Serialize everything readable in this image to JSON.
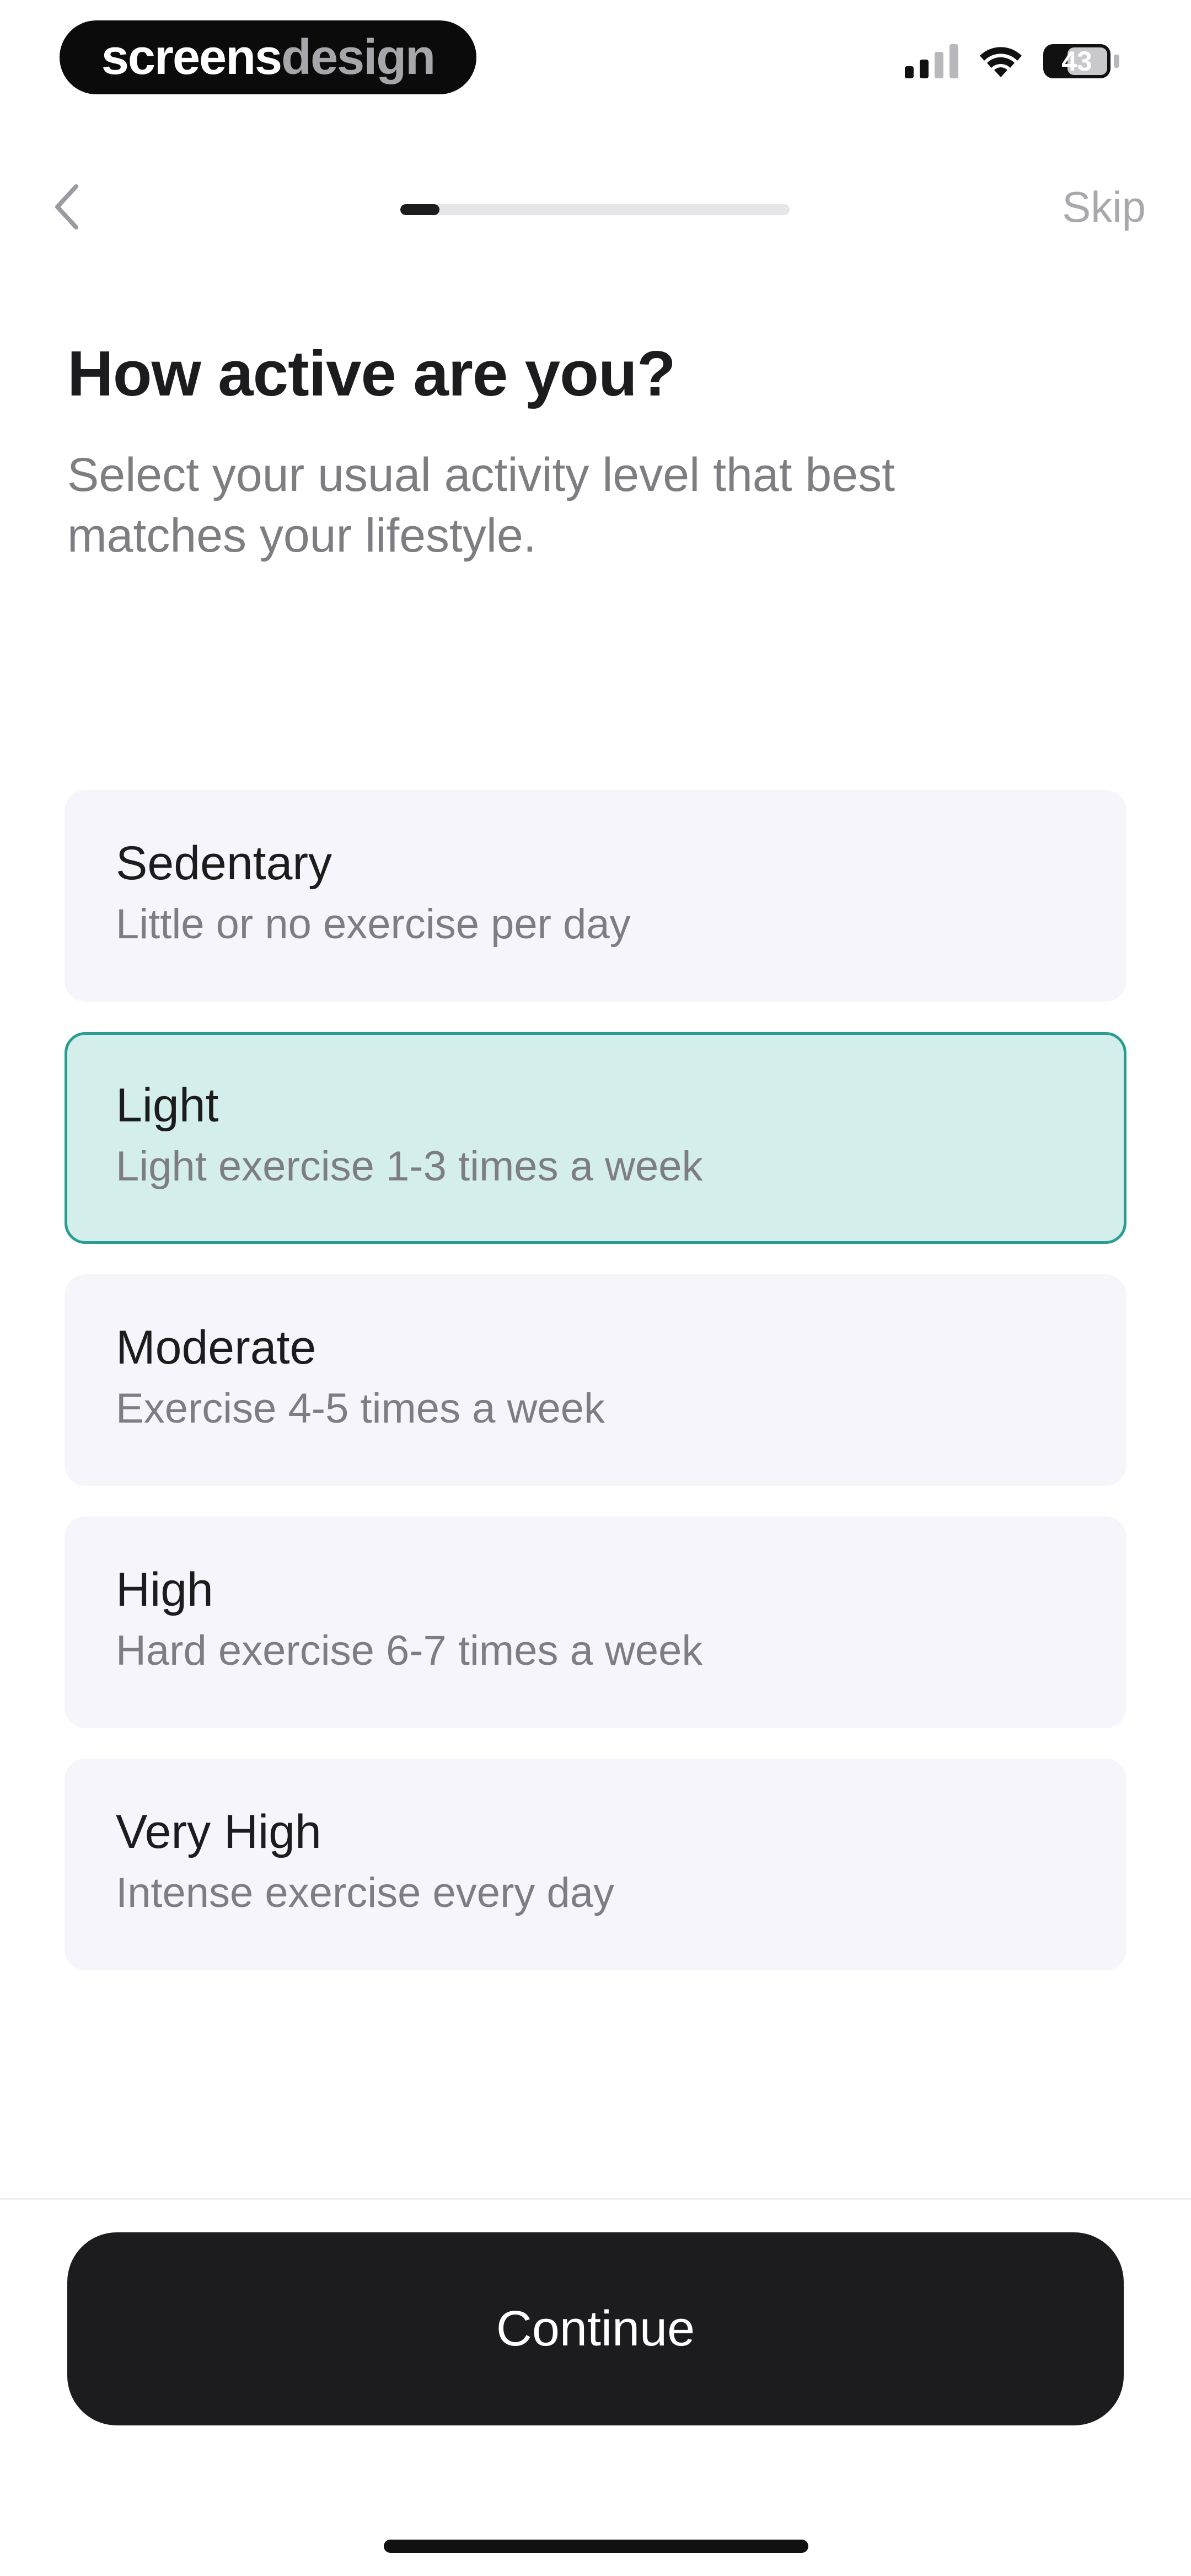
{
  "status_bar": {
    "brand_part1": "screens",
    "brand_part2": "design",
    "battery_level": "43"
  },
  "nav": {
    "progress": 0.1,
    "skip_label": "Skip"
  },
  "header": {
    "title": "How active are you?",
    "subtitle": "Select your usual activity level that best matches your lifestyle."
  },
  "options": [
    {
      "title": "Sedentary",
      "desc": "Little or no exercise per day",
      "selected": false
    },
    {
      "title": "Light",
      "desc": "Light exercise 1-3 times a week",
      "selected": true
    },
    {
      "title": "Moderate",
      "desc": "Exercise 4-5 times a week",
      "selected": false
    },
    {
      "title": "High",
      "desc": "Hard exercise 6-7 times a week",
      "selected": false
    },
    {
      "title": "Very High",
      "desc": "Intense exercise every day",
      "selected": false
    }
  ],
  "footer": {
    "continue_label": "Continue"
  },
  "colors": {
    "accent_border": "#2a9c90",
    "accent_fill": "#d3eeeb",
    "option_bg": "#f6f5fc",
    "button_bg": "#1c1b1e"
  },
  "icons": {
    "back": "chevron-left-icon",
    "signal": "cellular-signal-icon",
    "wifi": "wifi-icon",
    "battery": "battery-icon"
  }
}
